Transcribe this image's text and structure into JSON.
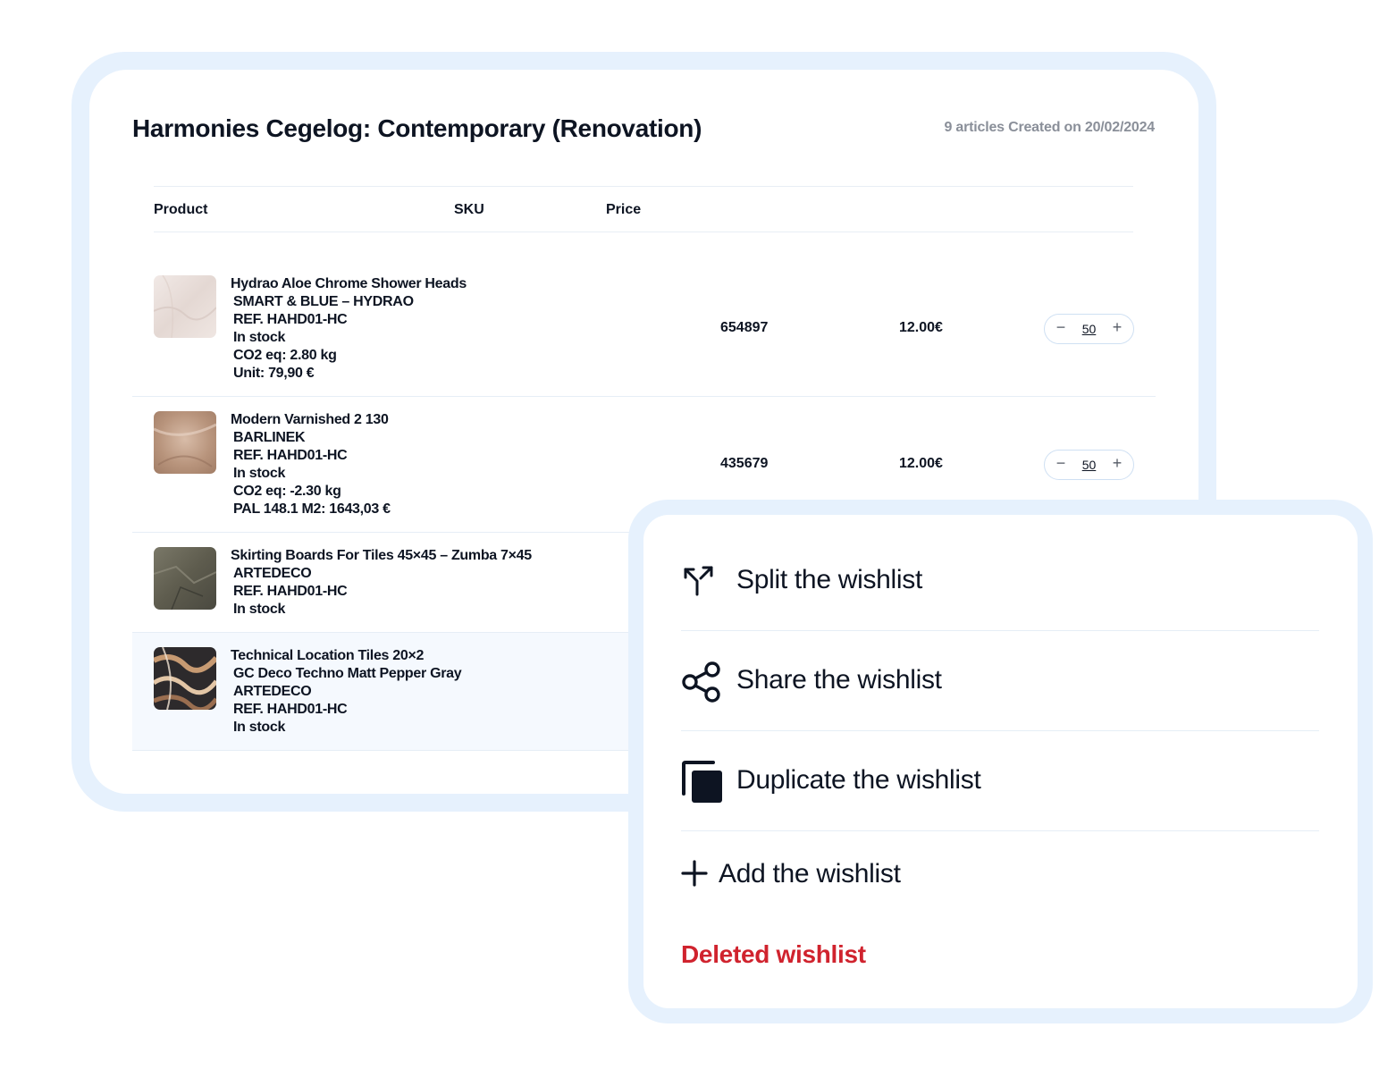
{
  "wishlist": {
    "title": "Harmonies Cegelog: Contemporary (Renovation)",
    "meta": "9 articles Created on 20/02/2024"
  },
  "table": {
    "headers": [
      "Product",
      "SKU",
      "Price"
    ],
    "rows": [
      {
        "lines": [
          "Hydrao Aloe Chrome Shower Heads",
          "SMART & BLUE – HYDRAO",
          "REF. HAHD01-HC",
          "In stock",
          "CO2 eq: 2.80 kg",
          "Unit: 79,90 €"
        ],
        "sku": "654897",
        "price": "12.00€",
        "qty": "50"
      },
      {
        "lines": [
          "Modern Varnished 2 130",
          "BARLINEK",
          "REF. HAHD01-HC",
          "In stock",
          "CO2 eq: -2.30 kg",
          "PAL 148.1 M2: 1643,03 €"
        ],
        "sku": "435679",
        "price": "12.00€",
        "qty": "50"
      },
      {
        "lines": [
          "Skirting Boards For Tiles 45×45 – Zumba 7×45",
          "ARTEDECO",
          "REF. HAHD01-HC",
          "In stock"
        ]
      },
      {
        "lines": [
          "Technical Location Tiles 20×2",
          "GC Deco Techno Matt Pepper Gray",
          "ARTEDECO",
          "REF. HAHD01-HC",
          "In stock"
        ]
      }
    ]
  },
  "stepper": {
    "minus": "−",
    "plus": "+"
  },
  "menu": {
    "items": [
      {
        "label": "Split the wishlist",
        "icon": "split-icon"
      },
      {
        "label": "Share the wishlist",
        "icon": "share-icon"
      },
      {
        "label": "Duplicate the wishlist",
        "icon": "duplicate-icon"
      },
      {
        "label": "Add the wishlist",
        "icon": "plus-icon"
      }
    ],
    "delete_label": "Deleted wishlist"
  },
  "colors": {
    "frame": "#e6f1fd",
    "danger": "#d0232e",
    "highlight_row": "#f5f9fe"
  }
}
